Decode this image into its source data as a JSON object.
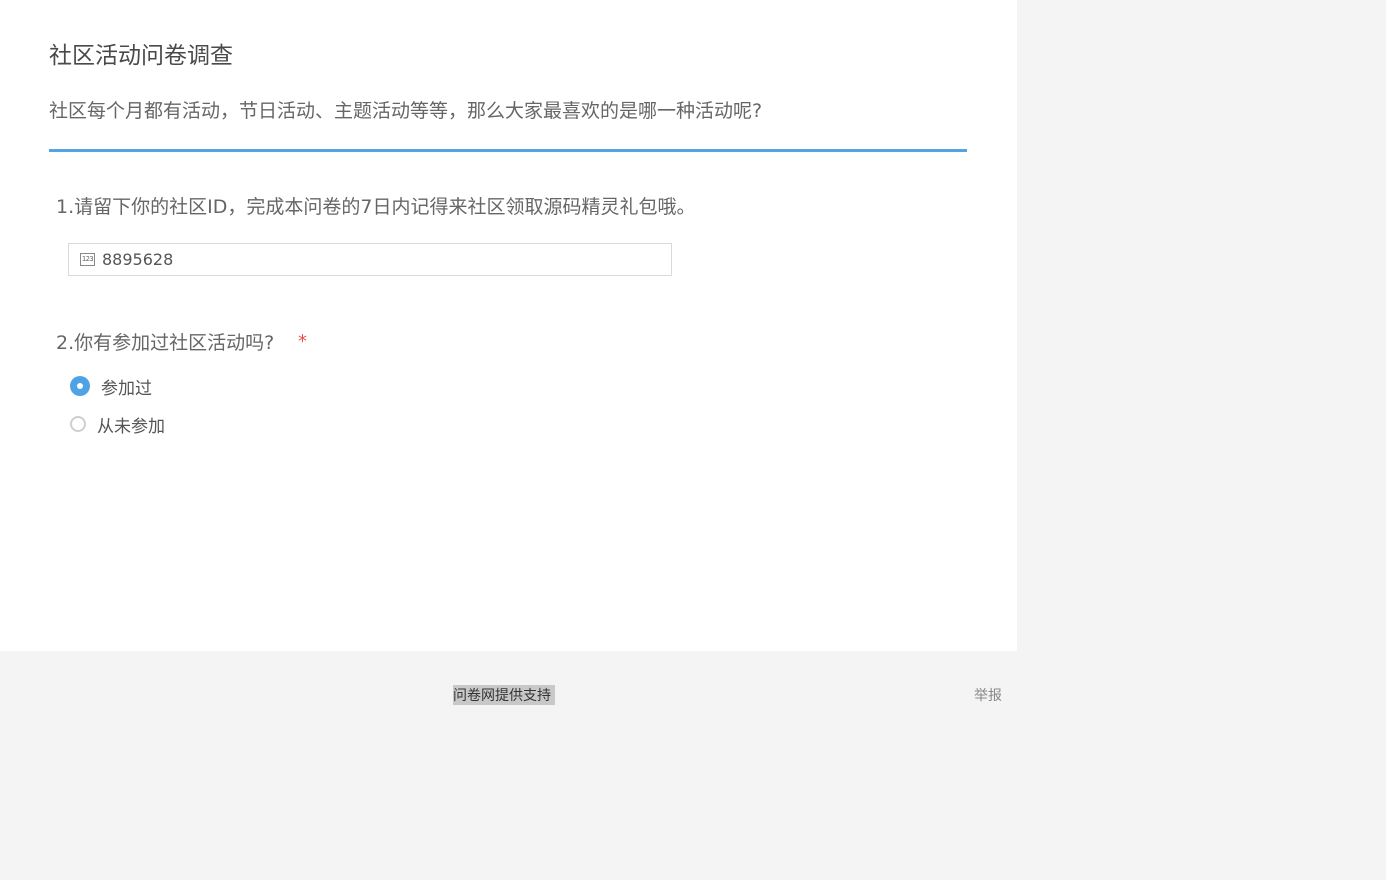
{
  "survey": {
    "title": "社区活动问卷调查",
    "description": "社区每个月都有活动，节日活动、主题活动等等，那么大家最喜欢的是哪一种活动呢?"
  },
  "questions": [
    {
      "title": "1.请留下你的社区ID，完成本问卷的7日内记得来社区领取源码精灵礼包哦。",
      "input_icon": "number-icon",
      "input_icon_text": "123",
      "value": "8895628"
    },
    {
      "title": "2.你有参加过社区活动吗?",
      "required_marker": "*",
      "options": [
        {
          "label": "参加过",
          "selected": true
        },
        {
          "label": "从未参加",
          "selected": false
        }
      ]
    }
  ],
  "footer": {
    "support_text": "问卷网提供支持",
    "report_text": "举报"
  },
  "colors": {
    "accent": "#53a4e5",
    "radio_selected": "#4ea3e6",
    "required": "#e94f4f",
    "page_background": "#f4f4f4"
  }
}
